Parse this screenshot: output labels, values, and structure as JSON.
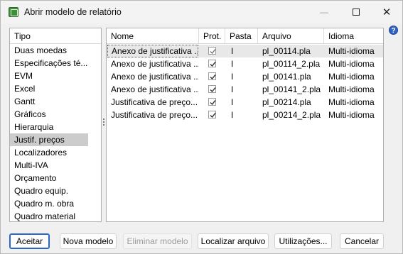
{
  "window": {
    "title": "Abrir modelo de relatório"
  },
  "type_list": {
    "header": "Tipo",
    "selected_index": 9,
    "items": [
      "Duas moedas",
      "Especificações té...",
      "EVM",
      "Excel",
      "Gantt",
      "Gráficos",
      "Hierarquia",
      "Justif. preços",
      "Localizadores",
      "Multi-IVA",
      "Orçamento",
      "Quadro equip.",
      "Quadro m. obra",
      "Quadro material"
    ]
  },
  "grid": {
    "columns": [
      "Nome",
      "Prot.",
      "Pasta",
      "Arquivo",
      "Idioma"
    ],
    "rows": [
      {
        "nome": "Anexo de justificativa ...",
        "prot": true,
        "pasta": "I",
        "arquivo": "pl_00114.pla",
        "idioma": "Multi-idioma"
      },
      {
        "nome": "Anexo de justificativa ...",
        "prot": true,
        "pasta": "I",
        "arquivo": "pl_00114_2.pla",
        "idioma": "Multi-idioma"
      },
      {
        "nome": "Anexo de justificativa ...",
        "prot": true,
        "pasta": "I",
        "arquivo": "pl_00141.pla",
        "idioma": "Multi-idioma"
      },
      {
        "nome": "Anexo de justificativa ...",
        "prot": true,
        "pasta": "I",
        "arquivo": "pl_00141_2.pla",
        "idioma": "Multi-idioma"
      },
      {
        "nome": "Justificativa de preço...",
        "prot": true,
        "pasta": "I",
        "arquivo": "pl_00214.pla",
        "idioma": "Multi-idioma"
      },
      {
        "nome": "Justificativa de preço...",
        "prot": true,
        "pasta": "I",
        "arquivo": "pl_00214_2.pla",
        "idioma": "Multi-idioma"
      }
    ]
  },
  "buttons": {
    "accept": "Aceitar",
    "new_model": "Nova modelo",
    "delete_model": "Eliminar modelo",
    "locate_file": "Localizar arquivo",
    "usages": "Utilizações...",
    "cancel": "Cancelar"
  },
  "icons": {
    "app": "report-template-icon",
    "help": "help-icon",
    "help_glyph": "?",
    "minimize_glyph": "—",
    "close_glyph": "✕"
  },
  "colors": {
    "selection_gray": "#cccccc",
    "primary_border": "#2b66c9"
  }
}
